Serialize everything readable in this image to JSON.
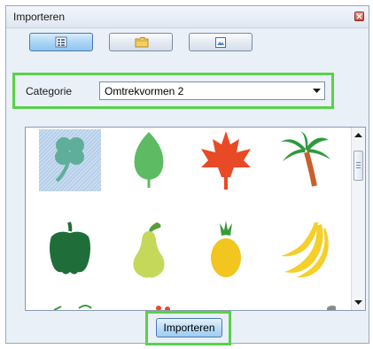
{
  "window": {
    "title": "Importeren"
  },
  "toolbar": {
    "buttons": [
      {
        "icon": "list-view-icon",
        "active": true
      },
      {
        "icon": "folder-icon",
        "active": false
      },
      {
        "icon": "image-file-icon",
        "active": false
      }
    ]
  },
  "category": {
    "label": "Categorie",
    "value": "Omtrekvormen 2"
  },
  "gallery": {
    "items": [
      {
        "icon": "clover-icon",
        "color": "#5fae9a",
        "selected": true
      },
      {
        "icon": "leaf-icon",
        "color": "#5dbb63",
        "selected": false
      },
      {
        "icon": "maple-leaf-icon",
        "color": "#e84a26",
        "selected": false
      },
      {
        "icon": "palm-tree-icon",
        "color": "#2f9a3c",
        "selected": false
      },
      {
        "icon": "bell-pepper-icon",
        "color": "#1f6e3a",
        "selected": false
      },
      {
        "icon": "pear-icon",
        "color": "#c6d85a",
        "selected": false
      },
      {
        "icon": "pineapple-icon",
        "color": "#f2c51f",
        "selected": false
      },
      {
        "icon": "bananas-icon",
        "color": "#f5cf2a",
        "selected": false
      }
    ]
  },
  "actions": {
    "import_label": "Importeren"
  },
  "colors": {
    "highlight": "#5ad14a",
    "window_bg": "#eaf0f8",
    "active_button": "#a8d4f5"
  }
}
